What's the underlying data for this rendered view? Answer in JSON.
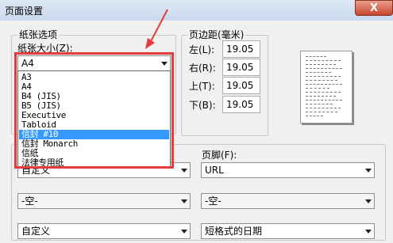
{
  "window": {
    "title": "页面设置",
    "close_glyph": "X"
  },
  "paper": {
    "group_title": "纸张选项",
    "size_label": "纸张大小(Z):",
    "size_value": "A4",
    "options": [
      "A3",
      "A4",
      "B4 (JIS)",
      "B5 (JIS)",
      "Executive",
      "Tabloid",
      "信封 #10",
      "信封 Monarch",
      "信纸",
      "法律专用纸"
    ],
    "selected_option": "信封 #10"
  },
  "margins": {
    "group_title": "页边距(毫米)",
    "left_label": "左(L):",
    "left_value": "19.05",
    "right_label": "右(R):",
    "right_value": "19.05",
    "top_label": "上(T):",
    "top_value": "19.05",
    "bottom_label": "下(B):",
    "bottom_value": "19.05"
  },
  "header_footer": {
    "footer_label": "页脚(F):",
    "header_rows": [
      "自定义",
      "-空-",
      "自定义"
    ],
    "footer_rows": [
      "URL",
      "-空-",
      "短格式的日期"
    ]
  },
  "colors": {
    "highlight": "#e53b3b",
    "selection": "#3399ff"
  }
}
